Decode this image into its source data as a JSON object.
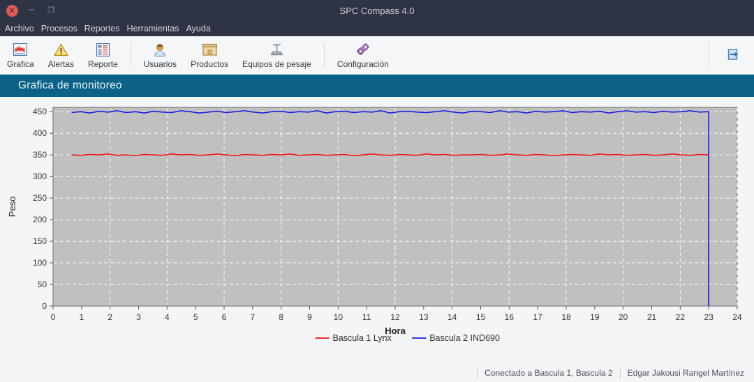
{
  "window": {
    "title": "SPC Compass 4.0",
    "close_icon": "close-icon",
    "minimize_icon": "minimize-icon",
    "maximize_icon": "maximize-icon",
    "close_glyph": "✕",
    "minimize_glyph": "−",
    "maximize_glyph": "❐"
  },
  "menubar": {
    "items": [
      {
        "label": "Archivo"
      },
      {
        "label": "Procesos"
      },
      {
        "label": "Reportes"
      },
      {
        "label": "Herramientas"
      },
      {
        "label": "Ayuda"
      }
    ]
  },
  "toolbar": {
    "group1": [
      {
        "label": "Grafica",
        "icon": "chart-icon"
      },
      {
        "label": "Alertas",
        "icon": "warning-triangle-icon"
      },
      {
        "label": "Reporte",
        "icon": "report-list-icon"
      }
    ],
    "group2": [
      {
        "label": "Usuarios",
        "icon": "user-icon"
      },
      {
        "label": "Productos",
        "icon": "box-icon"
      },
      {
        "label": "Equipos de pesaje",
        "icon": "scale-icon"
      }
    ],
    "group3": [
      {
        "label": "Configuración",
        "icon": "gears-icon"
      }
    ],
    "logout": {
      "label": "",
      "icon": "logout-door-icon"
    }
  },
  "page": {
    "title": "Grafica de monitoreo"
  },
  "statusbar": {
    "connection": "Conectado a Bascula 1, Bascula 2",
    "user": "Edgar Jakousi Rangel Martínez"
  },
  "colors": {
    "titlebar_bg": "#2f3445",
    "header_band": "#0b6286",
    "toolbar_bg": "#f5f6f8",
    "plot_bg": "#c0c0c0",
    "series1": "#ee1111",
    "series2": "#1818dd",
    "grid": "#ffffff"
  },
  "chart_data": {
    "type": "line",
    "title": "",
    "xlabel": "Hora",
    "ylabel": "Peso",
    "xlim": [
      0,
      24
    ],
    "ylim": [
      0,
      460
    ],
    "xticks": [
      0,
      1,
      2,
      3,
      4,
      5,
      6,
      7,
      8,
      9,
      10,
      11,
      12,
      13,
      14,
      15,
      16,
      17,
      18,
      19,
      20,
      21,
      22,
      23,
      24
    ],
    "yticks": [
      0,
      50,
      100,
      150,
      200,
      250,
      300,
      350,
      400,
      450
    ],
    "grid": true,
    "legend_position": "bottom",
    "series": [
      {
        "name": "Bascula 1 Lynx",
        "color": "#ee1111",
        "mean": 350,
        "noise_amplitude": 3,
        "x_start": 0.65,
        "x_end": 23.0,
        "drop_to_zero_at": 23.0,
        "values": [
          350,
          349,
          351,
          350,
          352,
          349,
          350,
          348,
          351,
          350,
          349,
          352,
          350,
          351,
          349,
          350,
          352,
          350,
          348,
          351,
          350,
          349,
          351,
          350,
          352,
          349,
          350,
          351,
          349,
          350,
          351,
          348,
          350,
          352,
          350,
          349,
          351,
          350,
          349,
          352,
          350,
          351,
          349,
          350,
          350,
          351,
          349,
          350,
          352,
          350,
          349,
          351,
          350,
          348,
          350,
          351,
          350,
          349,
          352,
          350,
          351,
          349,
          350,
          351,
          349,
          350,
          352,
          350,
          349,
          351,
          350,
          0
        ]
      },
      {
        "name": "Bascula 2 IND690",
        "color": "#1818dd",
        "mean": 449,
        "noise_amplitude": 4,
        "x_start": 0.65,
        "x_end": 23.0,
        "drop_to_zero_at": 23.0,
        "values": [
          448,
          450,
          447,
          451,
          449,
          452,
          448,
          450,
          447,
          451,
          449,
          448,
          452,
          450,
          447,
          449,
          451,
          448,
          450,
          452,
          449,
          447,
          450,
          451,
          448,
          450,
          449,
          452,
          447,
          450,
          451,
          448,
          450,
          449,
          452,
          447,
          450,
          451,
          449,
          448,
          450,
          452,
          449,
          447,
          451,
          450,
          448,
          452,
          449,
          450,
          447,
          451,
          449,
          450,
          452,
          448,
          450,
          449,
          451,
          447,
          450,
          452,
          449,
          450,
          448,
          451,
          449,
          450,
          452,
          449,
          450,
          0
        ]
      }
    ]
  }
}
